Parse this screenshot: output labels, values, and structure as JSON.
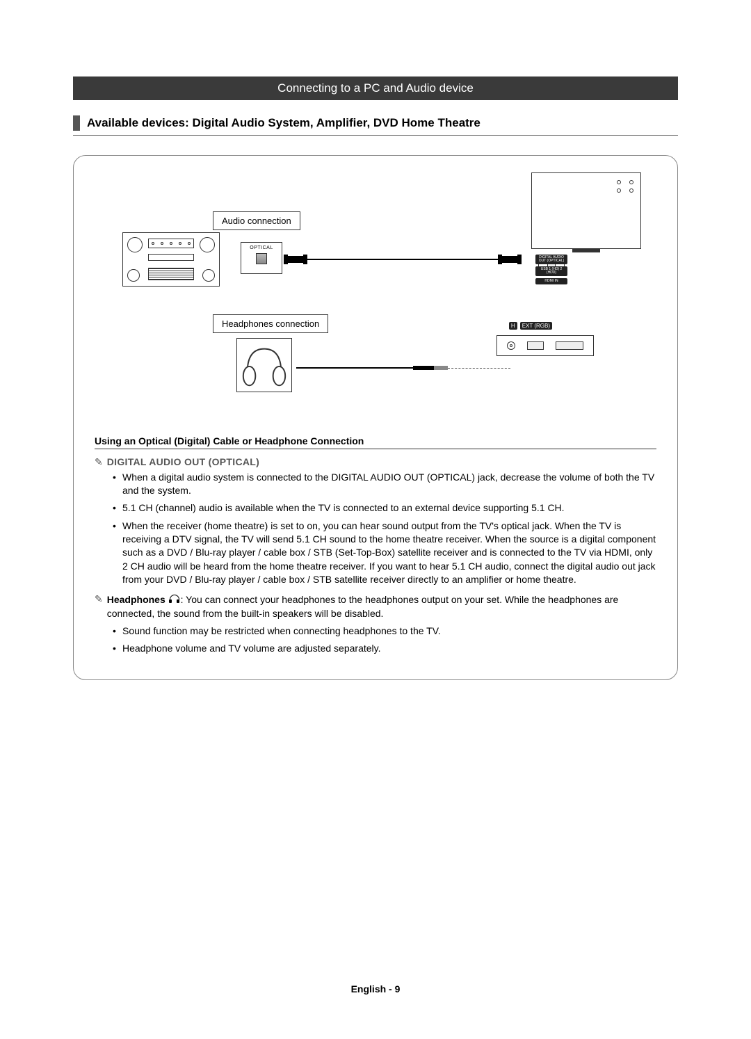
{
  "title_bar": "Connecting to a PC and Audio device",
  "subheading": "Available devices: Digital Audio System, Amplifier, DVD Home Theatre",
  "diagram": {
    "audio_label": "Audio connection",
    "headphones_label": "Headphones connection",
    "optical_label": "OPTICAL",
    "tv_ports": {
      "optical": "DIGITAL AUDIO OUT (OPTICAL)",
      "usb": "USB 1 (HD) 2 (HDD)",
      "hdmi": "HDMI IN"
    },
    "bottom_panel_ports": {
      "headphone_icon": "H",
      "ext": "EXT (RGB)"
    }
  },
  "section_title": "Using an Optical (Digital) Cable or Headphone Connection",
  "note1_label": "DIGITAL AUDIO OUT (OPTICAL)",
  "bullets1": [
    "When a digital audio system is connected to the DIGITAL AUDIO OUT (OPTICAL) jack, decrease the volume of both the TV and the system.",
    "5.1 CH (channel) audio is available when the TV is connected to an external device supporting 5.1 CH.",
    "When the receiver (home theatre) is set to on, you can hear sound output from the TV's optical jack. When the TV is receiving a DTV signal, the TV will send 5.1 CH sound to the home theatre receiver. When the source is a digital component such as a DVD / Blu-ray player / cable box / STB (Set-Top-Box) satellite receiver and is connected to the TV via HDMI, only 2 CH audio will be heard from the home theatre receiver. If you want to hear 5.1 CH audio, connect the digital audio out jack from your DVD / Blu-ray player / cable box / STB satellite receiver directly to an amplifier or home theatre."
  ],
  "note2_prefix_bold": "Headphones",
  "note2_text": ": You can connect your headphones to the headphones output on your set. While the headphones are connected, the sound from the built-in speakers will be disabled.",
  "bullets2": [
    "Sound function may be restricted when connecting headphones to the TV.",
    "Headphone volume and TV volume are adjusted separately."
  ],
  "footer": "English - 9"
}
